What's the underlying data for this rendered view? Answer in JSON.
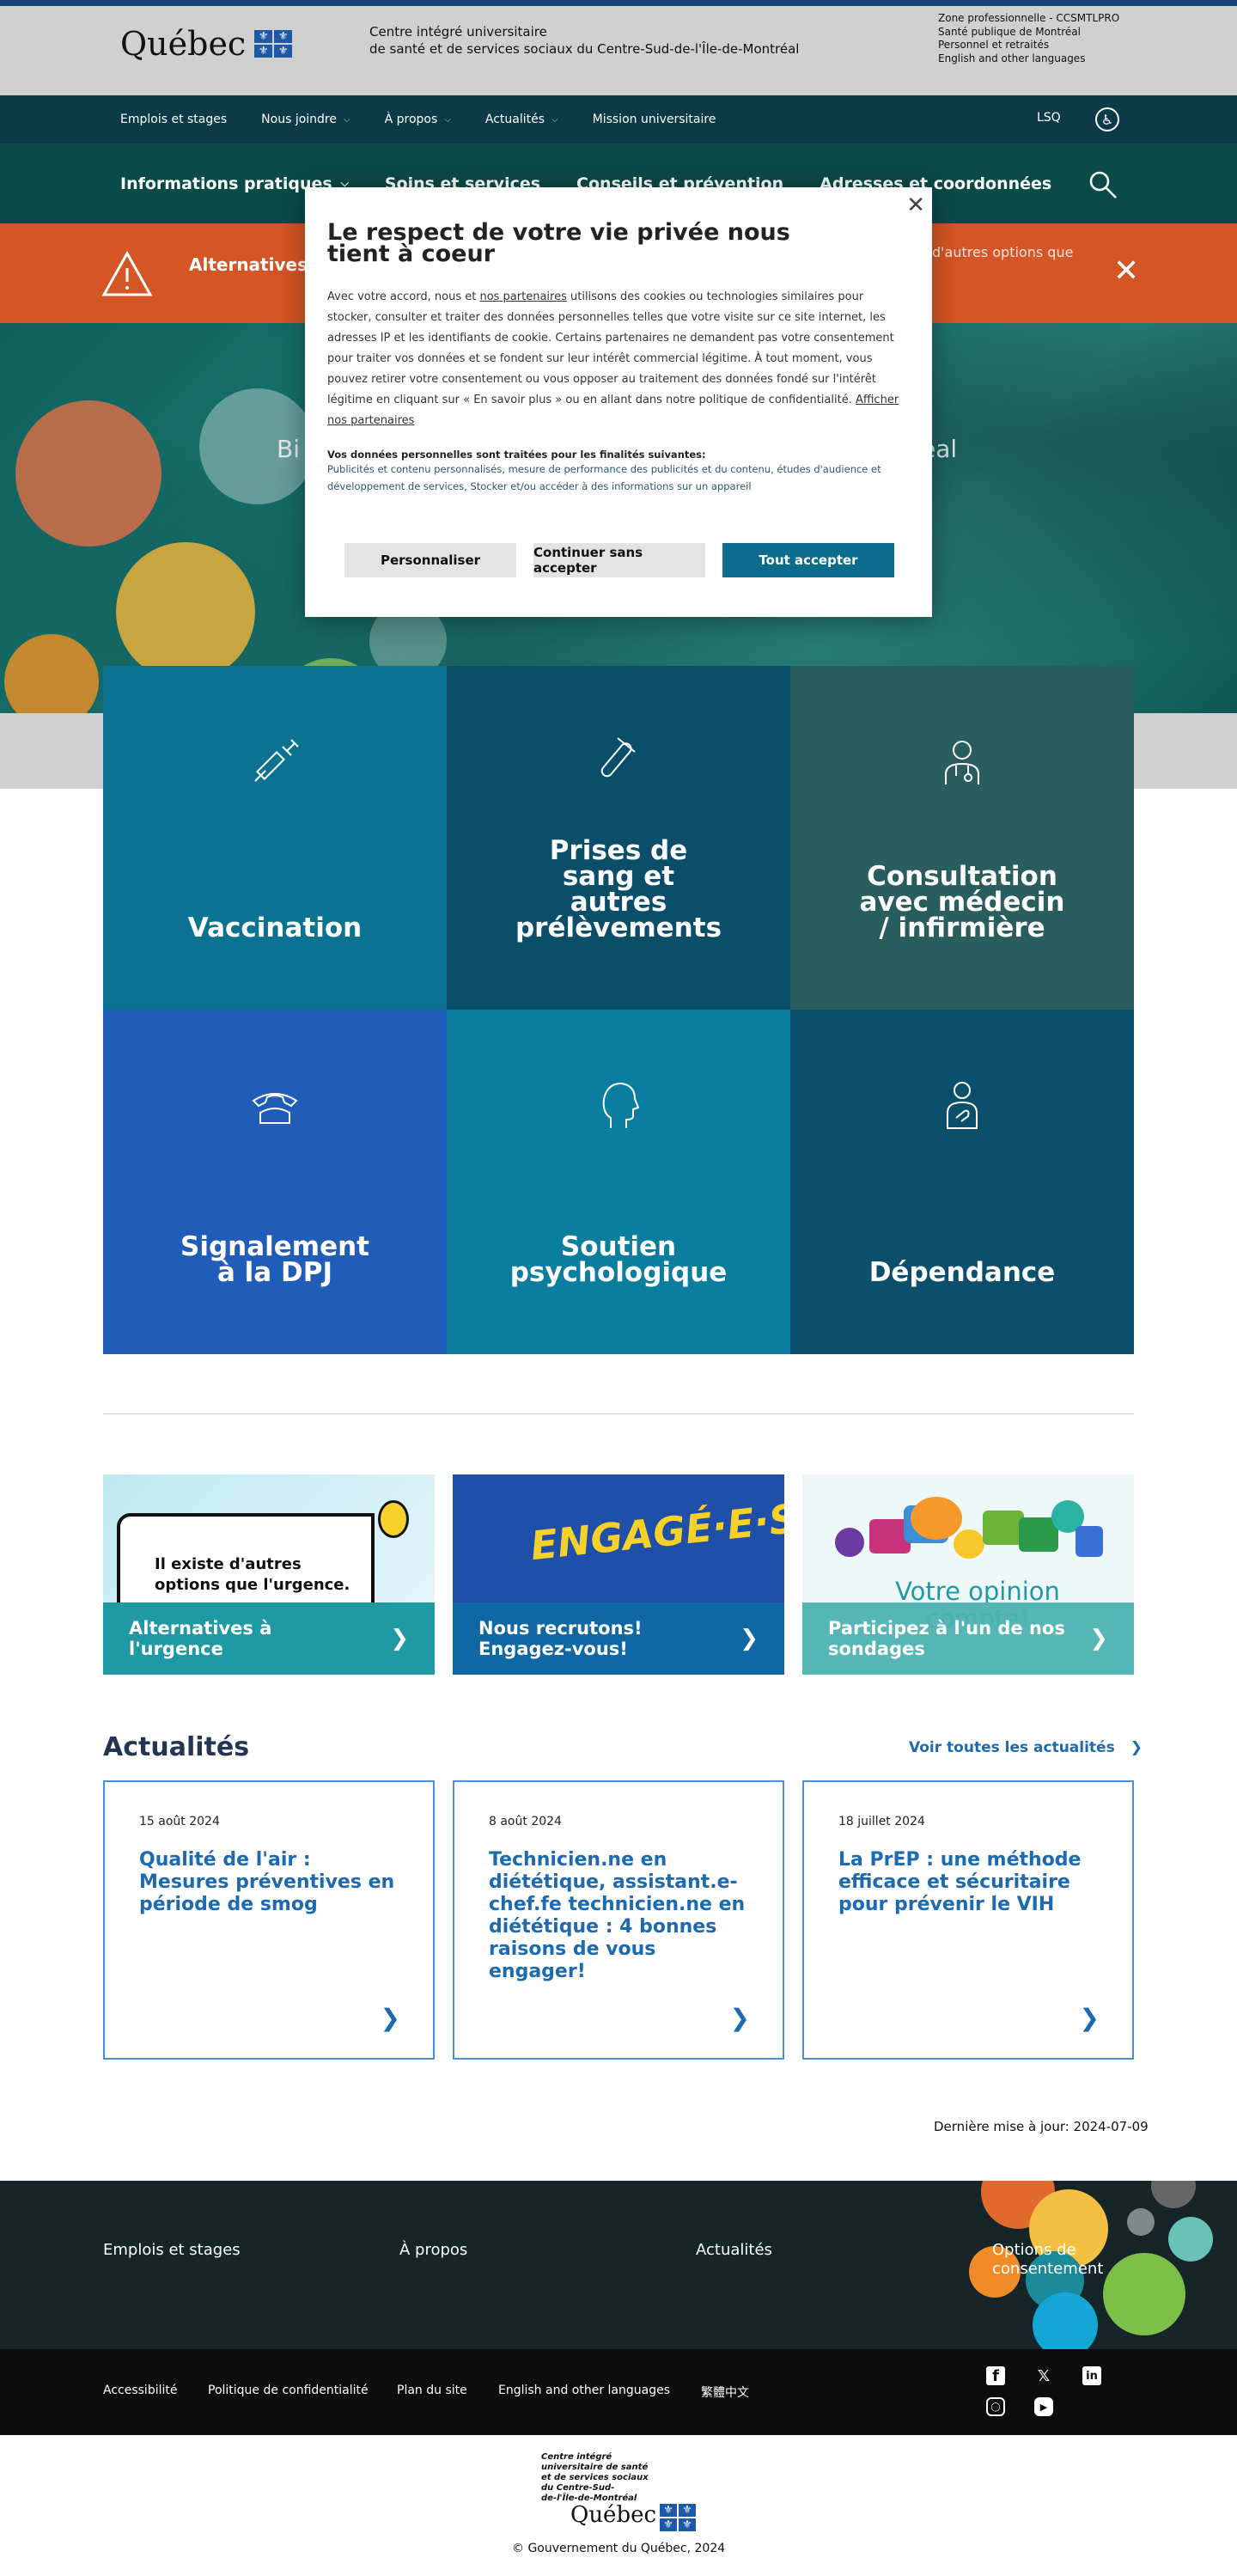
{
  "header": {
    "brand": "Québec",
    "org_line1": "Centre intégré universitaire",
    "org_line2": "de santé et de services sociaux du Centre-Sud-de-l'Île-de-Montréal",
    "quick_links": [
      "Zone professionnelle - CCSMTLPRO",
      "Santé publique de Montréal",
      "Personnel et retraités",
      "English and other languages"
    ]
  },
  "secondary_nav": {
    "items": [
      "Emplois et stages",
      "Nous joindre",
      "À propos",
      "Actualités",
      "Mission universitaire"
    ],
    "lsq": "LSQ"
  },
  "main_nav": {
    "items": [
      "Informations pratiques",
      "Soins et services",
      "Conseils et prévention",
      "Adresses et coordonnées"
    ]
  },
  "alert": {
    "title": "Alternatives à l'urgence",
    "text_partial": "d'autres options que"
  },
  "hero": {
    "welcome_left": "Bi",
    "welcome_right": "éal"
  },
  "tiles": [
    {
      "label": "Vaccination",
      "color": "#0b7391",
      "icon": "syringe-icon"
    },
    {
      "label": "Prises de\nsang et\nautres\nprélèvements",
      "color": "#0b4e6a",
      "icon": "test-tube-icon"
    },
    {
      "label": "Consultation\navec médecin\n/ infirmière",
      "color": "#2a5d5d",
      "icon": "doctor-icon"
    },
    {
      "label": "Signalement\nà la DPJ",
      "color": "#1f5db8",
      "icon": "phone-icon"
    },
    {
      "label": "Soutien\npsychologique",
      "color": "#0b7ea0",
      "icon": "head-icon"
    },
    {
      "label": "Dépendance",
      "color": "#0b4f6c",
      "icon": "person-hand-icon"
    }
  ],
  "promos": [
    {
      "label": "Alternatives à l'urgence",
      "image_text": "Il existe d'autres options que l'urgence.",
      "color": "#1f9aa5"
    },
    {
      "label": "Nous recrutons! Engagez-vous!",
      "image_text": "ENGAGÉ·E·S",
      "color": "#0f67a3"
    },
    {
      "label": "Participez à l'un de nos sondages",
      "image_text": "Votre opinion compte!",
      "color": "#4db3b2"
    }
  ],
  "news": {
    "heading": "Actualités",
    "see_all": "Voir toutes les actualités",
    "items": [
      {
        "date": "15 août 2024",
        "title": "Qualité de l'air : Mesures préventives en période de smog"
      },
      {
        "date": "8 août 2024",
        "title": "Technicien.ne en diététique, assistant.e-chef.fe technicien.ne en diététique : 4 bonnes raisons de vous engager!"
      },
      {
        "date": "18 juillet 2024",
        "title": "La PrEP : une méthode efficace et sécuritaire pour prévenir le VIH"
      }
    ]
  },
  "updated": "Dernière mise à jour: 2024-07-09",
  "footer": {
    "links1": [
      "Emplois et stages",
      "À propos",
      "Actualités",
      "Options de consentement"
    ],
    "links2": [
      "Accessibilité",
      "Politique de confidentialité",
      "Plan du site",
      "English and other languages",
      "繁體中文"
    ],
    "social": [
      "facebook-icon",
      "x-icon",
      "linkedin-icon",
      "instagram-icon",
      "youtube-icon"
    ],
    "org": "Centre intégré\nuniversitaire de santé\net de services sociaux\ndu Centre-Sud-\nde-l'Île-de-Montréal",
    "brand": "Québec",
    "copyright": "© Gouvernement du Québec, 2024"
  },
  "consent": {
    "title": "Le respect de votre vie privée nous tient à coeur",
    "body_a": "Avec votre accord, nous et ",
    "body_link": "nos partenaires",
    "body_b": " utilisons des cookies ou technologies similaires pour stocker, consulter et traiter des données personnelles telles que votre visite sur ce site internet, les adresses IP et les identifiants de cookie. Certains partenaires ne demandent pas votre consentement pour traiter vos données et se fondent sur leur intérêt commercial légitime. À tout moment, vous pouvez retirer votre consentement ou vous opposer au traitement des données fondé sur l'intérêt légitime en cliquant sur « En savoir plus » ou en allant dans notre politique de confidentialité. ",
    "body_link2": "Afficher nos partenaires",
    "purposes_heading": "Vos données personnelles sont traitées pour les finalités suivantes:",
    "purposes": "Publicités et contenu personnalisés, mesure de performance des publicités et du contenu, études d'audience et développement de services, Stocker et/ou accéder à des informations sur un appareil",
    "btn_customize": "Personnaliser",
    "btn_continue": "Continuer sans accepter",
    "btn_accept": "Tout accepter"
  }
}
